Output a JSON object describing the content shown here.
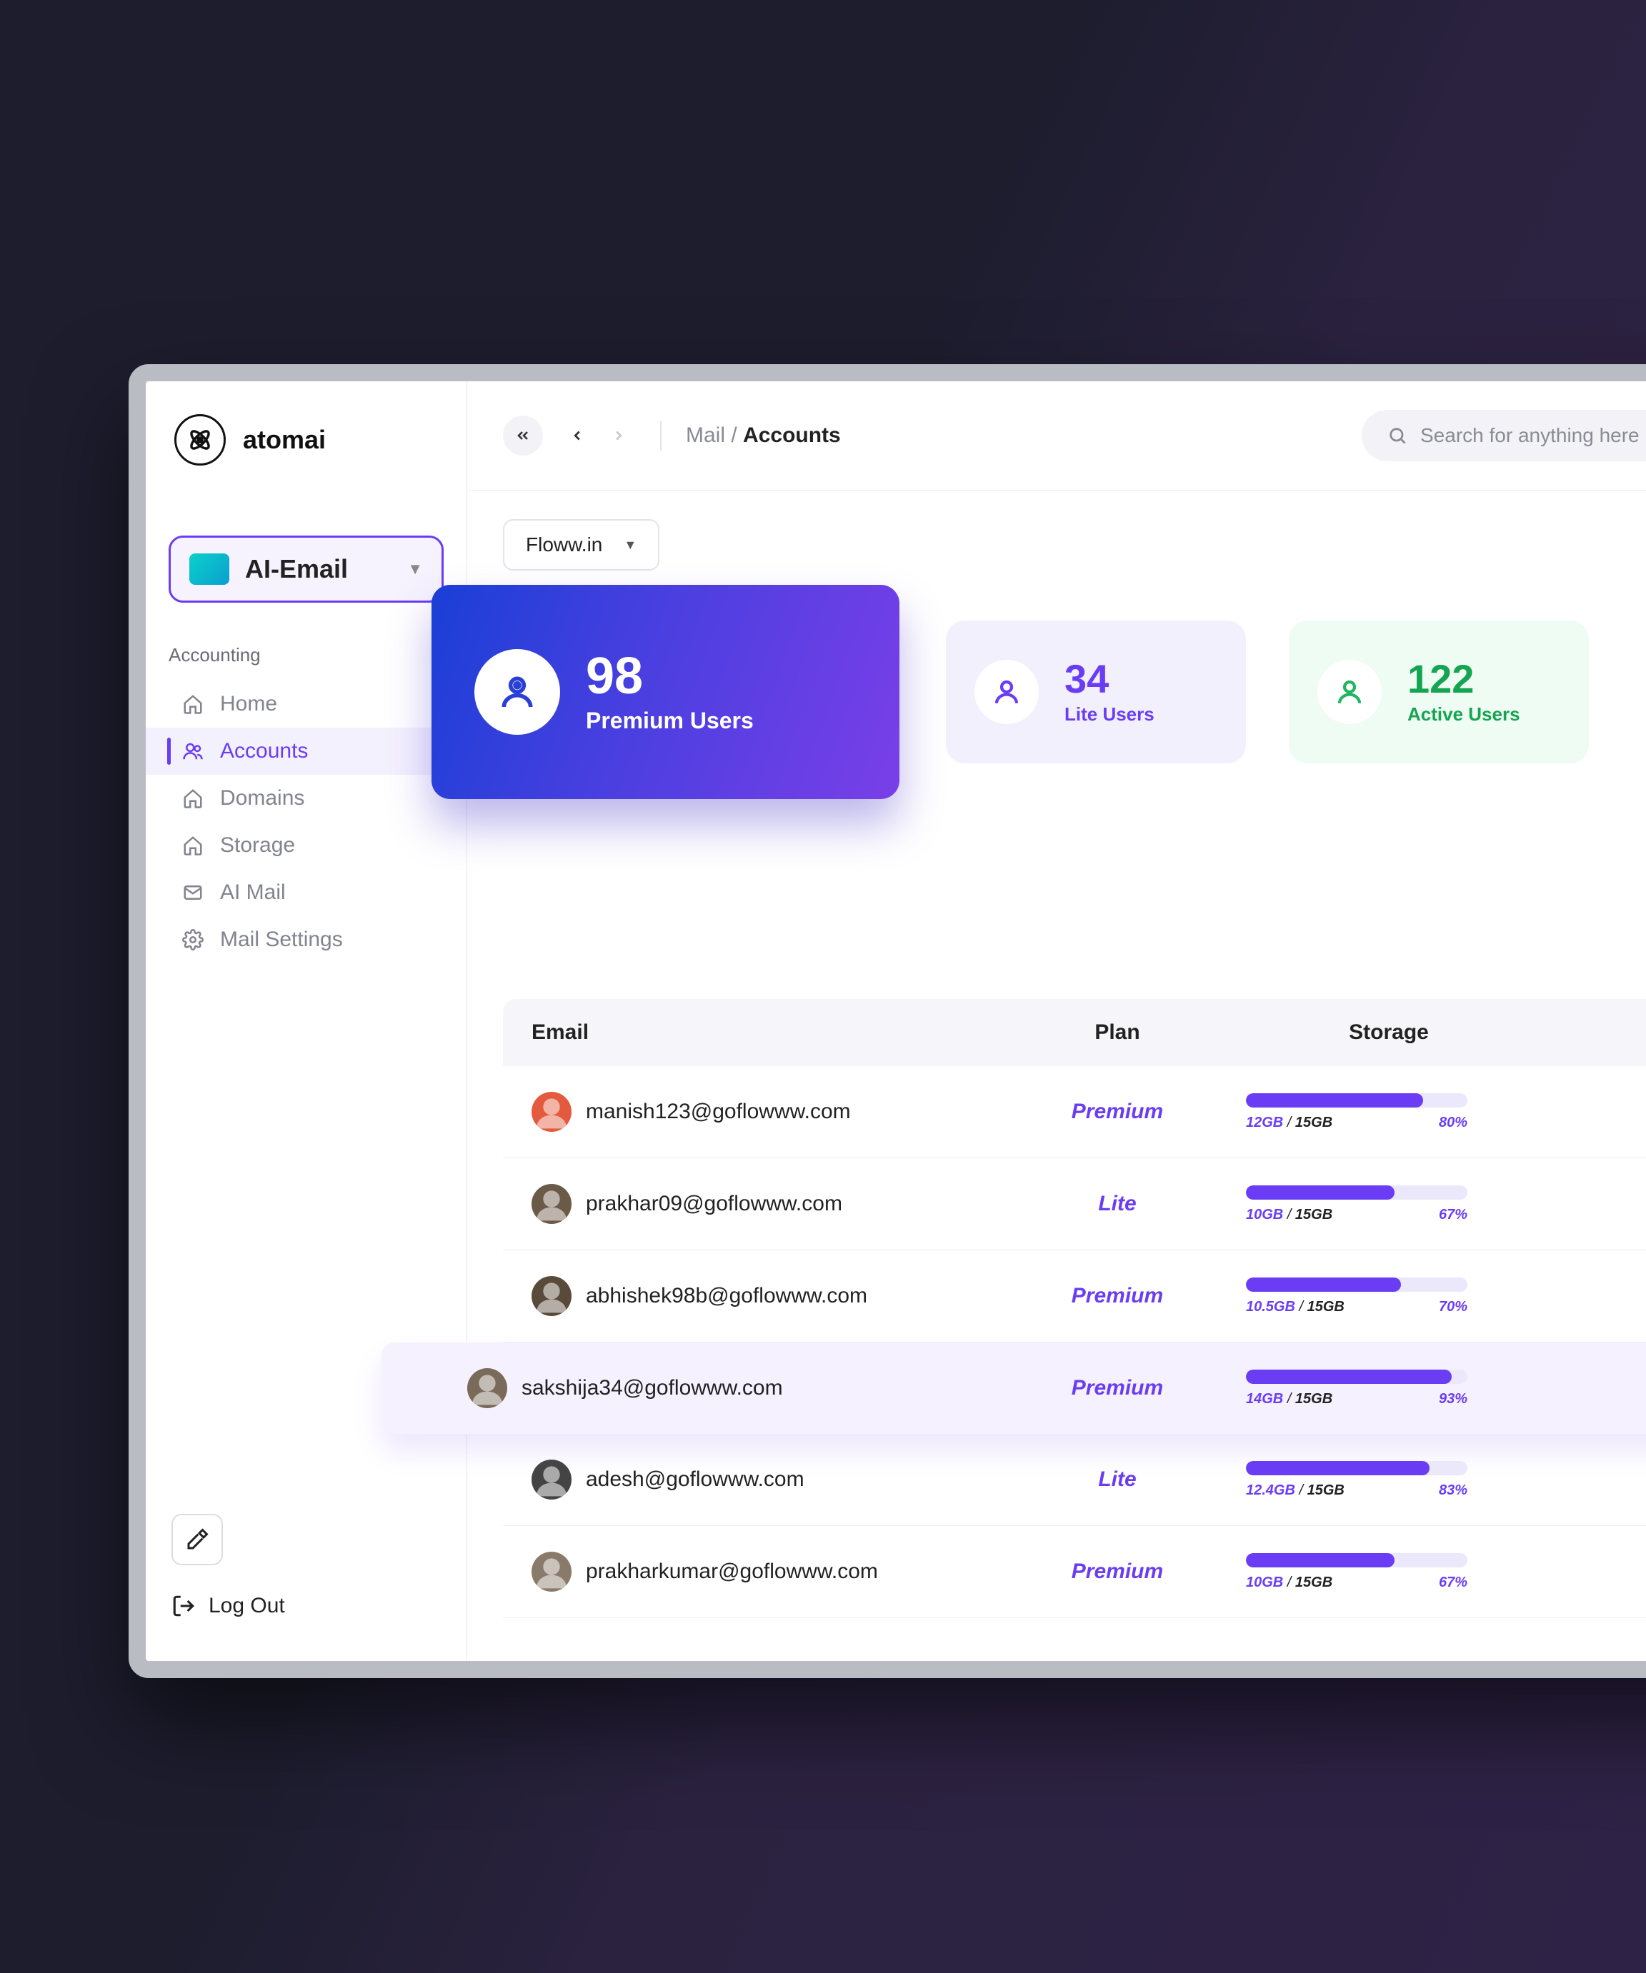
{
  "brand": {
    "name": "atomai"
  },
  "product_switch": {
    "label": "AI-Email"
  },
  "sidebar": {
    "section_label": "Accounting",
    "items": [
      {
        "label": "Home"
      },
      {
        "label": "Accounts"
      },
      {
        "label": "Domains"
      },
      {
        "label": "Storage"
      },
      {
        "label": "AI Mail"
      },
      {
        "label": "Mail Settings"
      }
    ],
    "logout_label": "Log Out"
  },
  "topbar": {
    "breadcrumb_root": "Mail",
    "breadcrumb_leaf": "Accounts",
    "search_placeholder": "Search for anything here"
  },
  "domain_select": {
    "value": "Floww.in"
  },
  "stats": {
    "premium": {
      "count": "98",
      "label": "Premium Users"
    },
    "lite": {
      "count": "34",
      "label": "Lite Users"
    },
    "active": {
      "count": "122",
      "label": "Active Users"
    }
  },
  "table": {
    "headers": {
      "email": "Email",
      "plan": "Plan",
      "storage": "Storage"
    },
    "rows": [
      {
        "email": "manish123@goflowww.com",
        "plan": "Premium",
        "used": "12GB",
        "total": "15GB",
        "pct": "80%",
        "pctnum": 80,
        "avatar": "#e45a3e"
      },
      {
        "email": "prakhar09@goflowww.com",
        "plan": "Lite",
        "used": "10GB",
        "total": "15GB",
        "pct": "67%",
        "pctnum": 67,
        "avatar": "#6b5a47"
      },
      {
        "email": "abhishek98b@goflowww.com",
        "plan": "Premium",
        "used": "10.5GB",
        "total": "15GB",
        "pct": "70%",
        "pctnum": 70,
        "avatar": "#5a4a3a"
      },
      {
        "email": "sakshija34@goflowww.com",
        "plan": "Premium",
        "used": "14GB",
        "total": "15GB",
        "pct": "93%",
        "pctnum": 93,
        "avatar": "#7a6a5a",
        "highlight": true
      },
      {
        "email": "adesh@goflowww.com",
        "plan": "Lite",
        "used": "12.4GB",
        "total": "15GB",
        "pct": "83%",
        "pctnum": 83,
        "avatar": "#444444"
      },
      {
        "email": "prakharkumar@goflowww.com",
        "plan": "Premium",
        "used": "10GB",
        "total": "15GB",
        "pct": "67%",
        "pctnum": 67,
        "avatar": "#8a7a6a"
      }
    ]
  }
}
